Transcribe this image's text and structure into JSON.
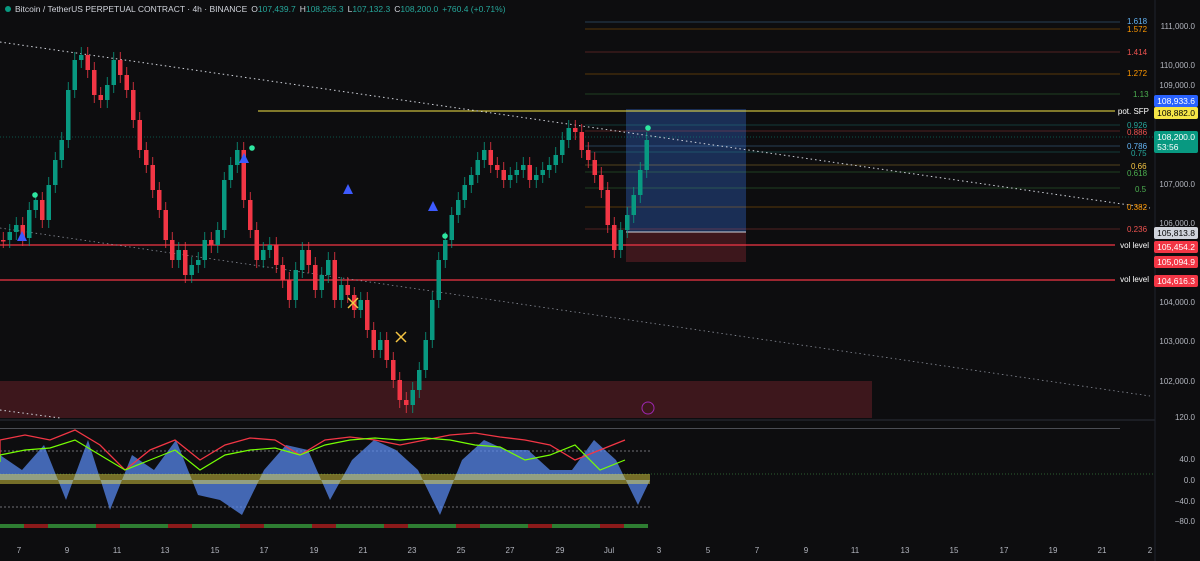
{
  "header": {
    "symbol": "Bitcoin / TetherUS PERPETUAL CONTRACT · 4h · BINANCE",
    "o_label": "O",
    "o_value": "107,439.7",
    "h_label": "H",
    "h_value": "108,265.3",
    "l_label": "L",
    "l_value": "107,132.3",
    "c_label": "C",
    "c_value": "108,200.0",
    "change": "+760.4 (+0.71%)"
  },
  "price_axis": [
    "111,000.0",
    "110,000.0",
    "109,000.0",
    "107,000.0",
    "106,000.0",
    "104,000.0",
    "103,000.0",
    "102,000.0"
  ],
  "price_tags": {
    "tag_blue": "108,933.6",
    "tag_spf": "108,882.0",
    "tag_spf_label": "pot. SFP",
    "tag_current": "108,200.0",
    "tag_countdown": "53:56",
    "tag_grey": "105,813.8",
    "tag_vol1": "105,454.2",
    "tag_red2": "105,094.9",
    "tag_vol2": "104,616.3",
    "vol_label": "vol level"
  },
  "fib_labels": [
    "1.618",
    "1.572",
    "1.414",
    "1.272",
    "1.13",
    "0.926",
    "0.886",
    "0.786",
    "0.75",
    "0.66",
    "0.618",
    "0.5",
    "0.382",
    "0.236"
  ],
  "osc_axis": [
    "120.0",
    "40.0",
    "0.0",
    "−40.0",
    "−80.0"
  ],
  "time_axis": [
    "7",
    "9",
    "11",
    "13",
    "15",
    "17",
    "19",
    "21",
    "23",
    "25",
    "27",
    "29",
    "Jul",
    "3",
    "5",
    "7",
    "9",
    "11",
    "13",
    "15",
    "17",
    "19",
    "21",
    "2"
  ],
  "colors": {
    "up": "#089981",
    "down": "#f23645",
    "fib_gold": "#f5c542",
    "fib_red": "#ef5350",
    "fib_green": "#4caf50",
    "blue_box": "#2962ff"
  }
}
